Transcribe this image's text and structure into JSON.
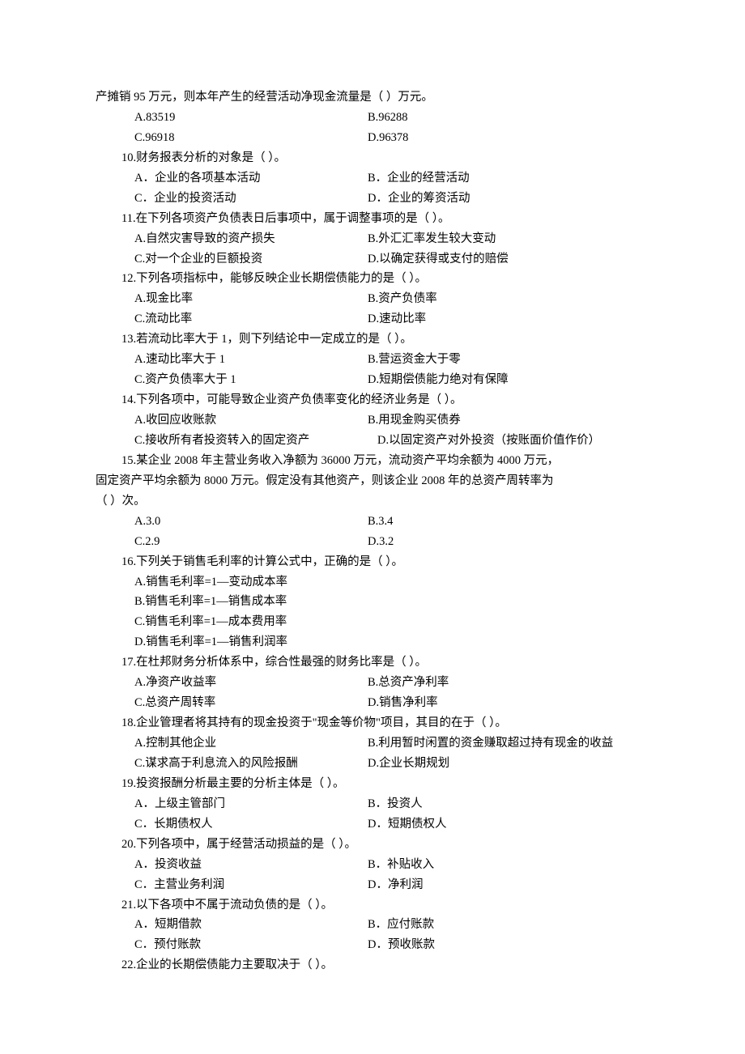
{
  "cont": {
    "line1": "产摊销 95 万元，则本年产生的经营活动净现金流量是（    ）万元。",
    "a": "A.83519",
    "b": "B.96288",
    "c": "C.96918",
    "d": "D.96378"
  },
  "q10": {
    "stem": "10.财务报表分析的对象是（     ）。",
    "a": "A．企业的各项基本活动",
    "b": "B．企业的经营活动",
    "c": "C．企业的投资活动",
    "d": "D．企业的筹资活动"
  },
  "q11": {
    "stem": "11.在下列各项资产负债表日后事项中，属于调整事项的是（    ）。",
    "a": "A.自然灾害导致的资产损失",
    "b": "B.外汇汇率发生较大变动",
    "c": "C.对一个企业的巨额投资",
    "d": "D.以确定获得或支付的赔偿"
  },
  "q12": {
    "stem": "12.下列各项指标中，能够反映企业长期偿债能力的是（    ）。",
    "a": "A.现金比率",
    "b": "B.资产负债率",
    "c": "C.流动比率",
    "d": "D.速动比率"
  },
  "q13": {
    "stem": "13.若流动比率大于 1，则下列结论中一定成立的是（    ）。",
    "a": "A.速动比率大于 1",
    "b": "B.营运资金大于零",
    "c": "C.资产负债率大于 1",
    "d": "D.短期偿债能力绝对有保障"
  },
  "q14": {
    "stem": "14.下列各项中，可能导致企业资产负债率变化的经济业务是（    ）。",
    "a": "A.收回应收账款",
    "b": "B.用现金购买债券",
    "c": "C.接收所有者投资转入的固定资产",
    "d": "D.以固定资产对外投资（按账面价值作价）"
  },
  "q15": {
    "line1": "15.某企业 2008 年主营业务收入净额为 36000 万元，流动资产平均余额为 4000 万元，",
    "line2": "固定资产平均余额为 8000 万元。假定没有其他资产，则该企业 2008 年的总资产周转率为",
    "line3": "（    ）次。",
    "a": "A.3.0",
    "b": "B.3.4",
    "c": "C.2.9",
    "d": "D.3.2"
  },
  "q16": {
    "stem": "16.下列关于销售毛利率的计算公式中，正确的是（     ）。",
    "a": "A.销售毛利率=1—变动成本率",
    "b": "B.销售毛利率=1—销售成本率",
    "c": "C.销售毛利率=1—成本费用率",
    "d": "D.销售毛利率=1—销售利润率"
  },
  "q17": {
    "stem": "17.在杜邦财务分析体系中，综合性最强的财务比率是（     ）。",
    "a": "A.净资产收益率",
    "b": "B.总资产净利率",
    "c": "C.总资产周转率",
    "d": "D.销售净利率"
  },
  "q18": {
    "stem": "18.企业管理者将其持有的现金投资于\"现金等价物\"项目，其目的在于（    ）。",
    "a": "A.控制其他企业",
    "b": "B.利用暂时闲置的资金赚取超过持有现金的收益",
    "c": "C.谋求高于利息流入的风险报酬",
    "d": "D.企业长期规划"
  },
  "q19": {
    "stem": "19.投资报酬分析最主要的分析主体是（    ）。",
    "a": "A．上级主管部门",
    "b": "B．投资人",
    "c": "C．长期债权人",
    "d": "D．短期债权人"
  },
  "q20": {
    "stem": "20.下列各项中，属于经营活动损益的是（    ）。",
    "a": "A．投资收益",
    "b": "B．补贴收入",
    "c": "C．主营业务利润",
    "d": "D．净利润"
  },
  "q21": {
    "stem": "21.以下各项中不属于流动负债的是（    ）。",
    "a": "A．短期借款",
    "b": "B．应付账款",
    "c": "C．预付账款",
    "d": "D．预收账款"
  },
  "q22": {
    "stem": "22.企业的长期偿债能力主要取决于（    ）。"
  }
}
